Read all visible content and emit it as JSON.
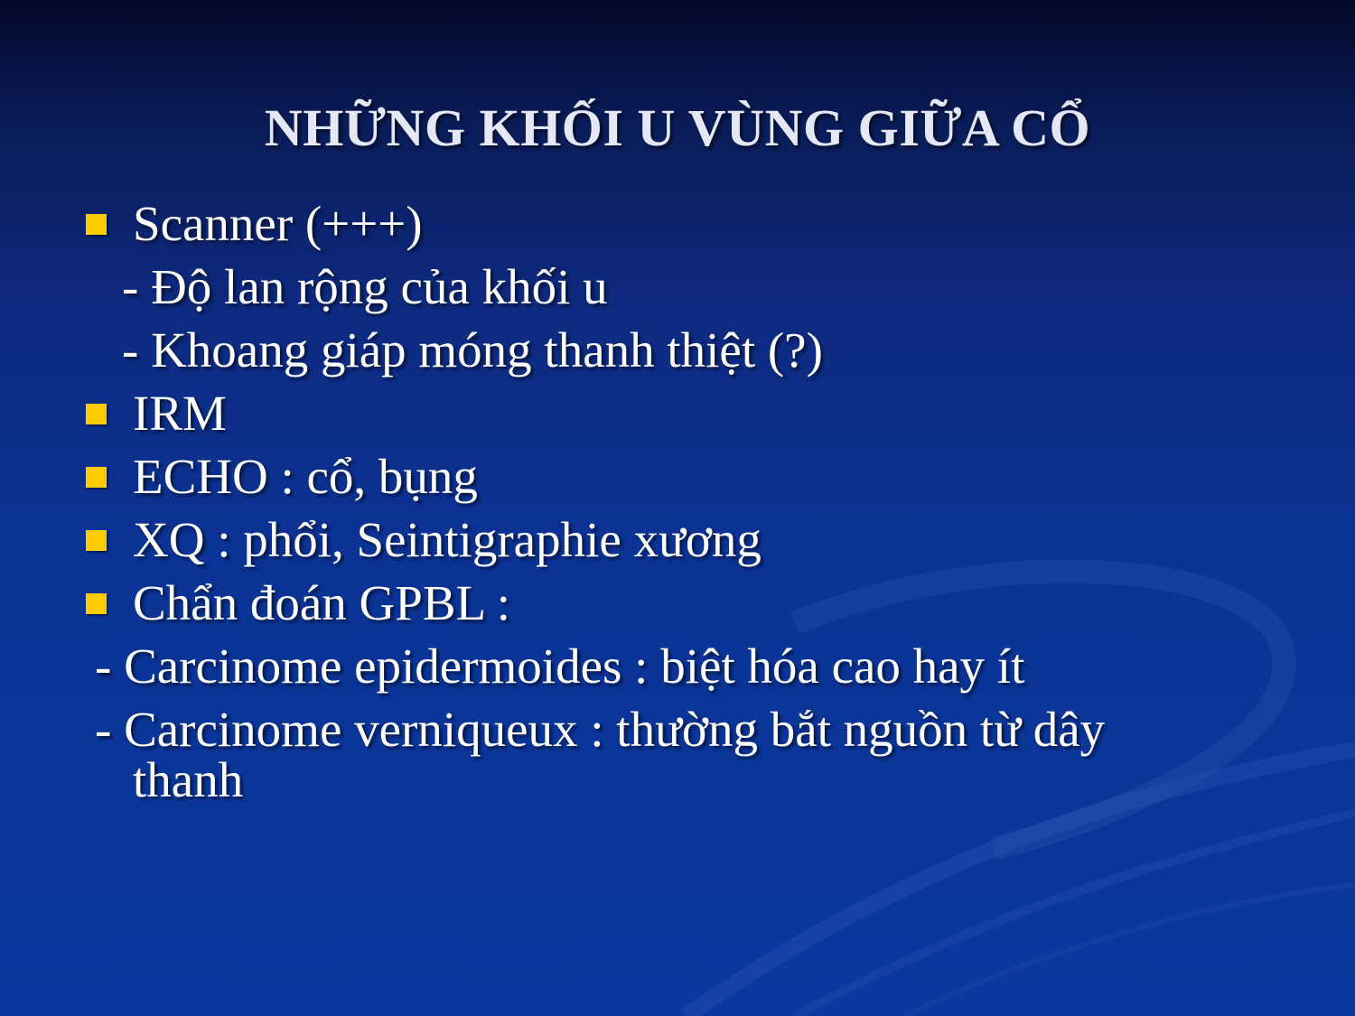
{
  "slide": {
    "title": "NHỮNG KHỐI U VÙNG GIỮA CỔ",
    "lines": [
      "Scanner (+++)",
      "- Độ lan rộng của khối u",
      "- Khoang giáp móng thanh thiệt (?)",
      "IRM",
      "ECHO : cổ, bụng",
      "XQ : phổi, Seintigraphie xương",
      "Chẩn đoán GPBL :",
      "- Carcinome epidermoides : biệt hóa cao hay ít",
      "- Carcinome verniqueux : thường bắt nguồn từ dây",
      "thanh"
    ]
  },
  "colors": {
    "background": "#0a389e",
    "bullet": "#ffcc00",
    "text": "#ffffff"
  }
}
